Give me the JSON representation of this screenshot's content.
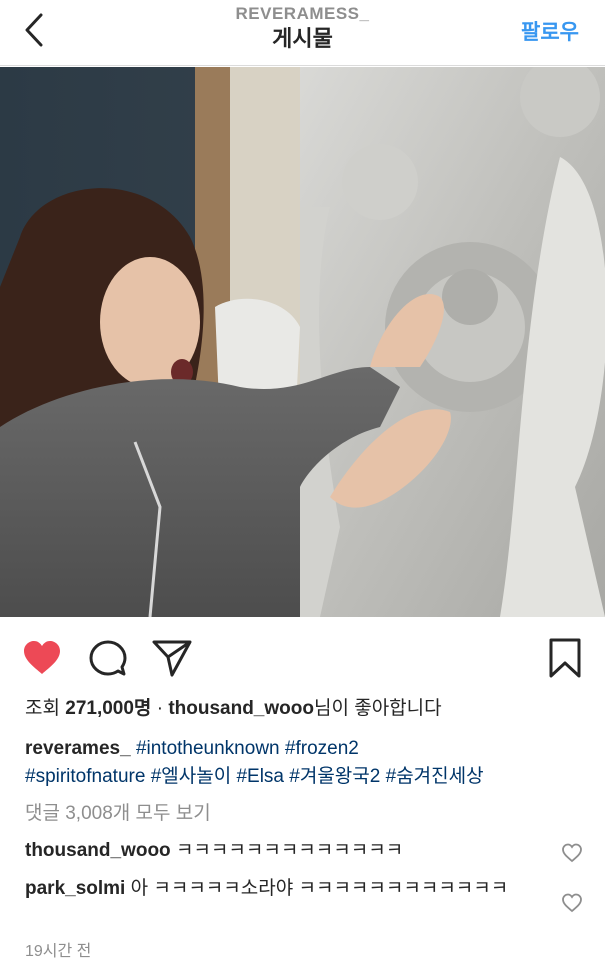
{
  "header": {
    "username": "REVERAMESS_",
    "title": "게시물",
    "follow_label": "팔로우"
  },
  "post": {
    "views_label": "조회",
    "views_count": "271,000명",
    "separator": "·",
    "liker": "thousand_wooo",
    "liked_text": "님이 좋아합니다",
    "caption_user": "reverames_",
    "hashtags": [
      "#intotheunknown",
      "#frozen2",
      "#spiritofnature",
      "#엘사놀이",
      "#Elsa",
      "#겨울왕국2",
      "#숨겨진세상"
    ],
    "view_comments": "댓글 3,008개 모두 보기",
    "time": "19시간 전"
  },
  "comments": [
    {
      "user": "thousand_wooo",
      "text": "ㅋㅋㅋㅋㅋㅋㅋㅋㅋㅋㅋㅋㅋ"
    },
    {
      "user": "park_solmi",
      "text": "아 ㅋㅋㅋㅋㅋ소라야 ㅋㅋㅋㅋㅋㅋㅋㅋㅋㅋㅋㅋ"
    }
  ],
  "colors": {
    "accent": "#3897f0",
    "like_red": "#ed4956",
    "hashtag": "#003569",
    "muted": "#8e8e8e"
  },
  "icons": [
    "back-chevron-icon",
    "heart-filled-icon",
    "comment-icon",
    "share-icon",
    "bookmark-icon",
    "comment-heart-icon"
  ]
}
